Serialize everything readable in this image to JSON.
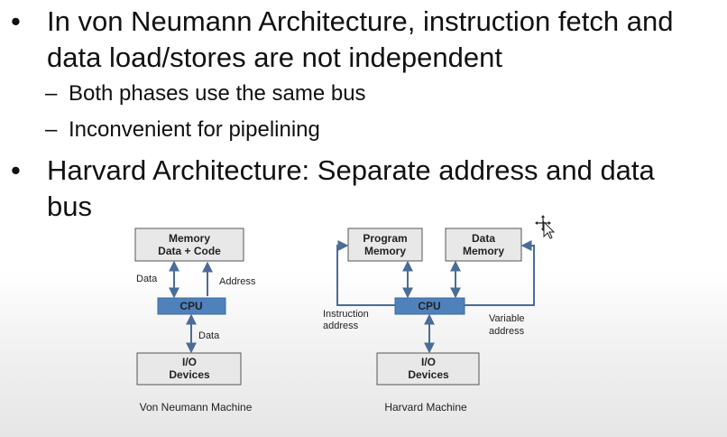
{
  "slide": {
    "bullet1": {
      "line1": "In von Neumann Architecture, instruction fetch and",
      "line2": "data load/stores are not independent"
    },
    "sub1": "Both phases use the same bus",
    "sub2": "Inconvenient for pipelining",
    "bullet2": {
      "line1": "Harvard Architecture: Separate address and data",
      "line2": "bus"
    },
    "bullet_glyph": "•",
    "dash_glyph": "–"
  },
  "von_neumann": {
    "memory_line1": "Memory",
    "memory_line2": "Data + Code",
    "cpu": "CPU",
    "io_line1": "I/O",
    "io_line2": "Devices",
    "data_label": "Data",
    "address_label": "Address",
    "data_label2": "Data",
    "caption": "Von Neumann Machine"
  },
  "harvard": {
    "prog_mem_line1": "Program",
    "prog_mem_line2": "Memory",
    "data_mem_line1": "Data",
    "data_mem_line2": "Memory",
    "cpu": "CPU",
    "io_line1": "I/O",
    "io_line2": "Devices",
    "instr_label1": "Instruction",
    "instr_label2": "address",
    "var_label1": "Variable",
    "var_label2": "address",
    "caption": "Harvard Machine"
  },
  "colors": {
    "box_fill": "#e8e8e8",
    "box_stroke": "#555555",
    "cpu_fill": "#4f81bd",
    "arrow": "#4a6c99"
  }
}
